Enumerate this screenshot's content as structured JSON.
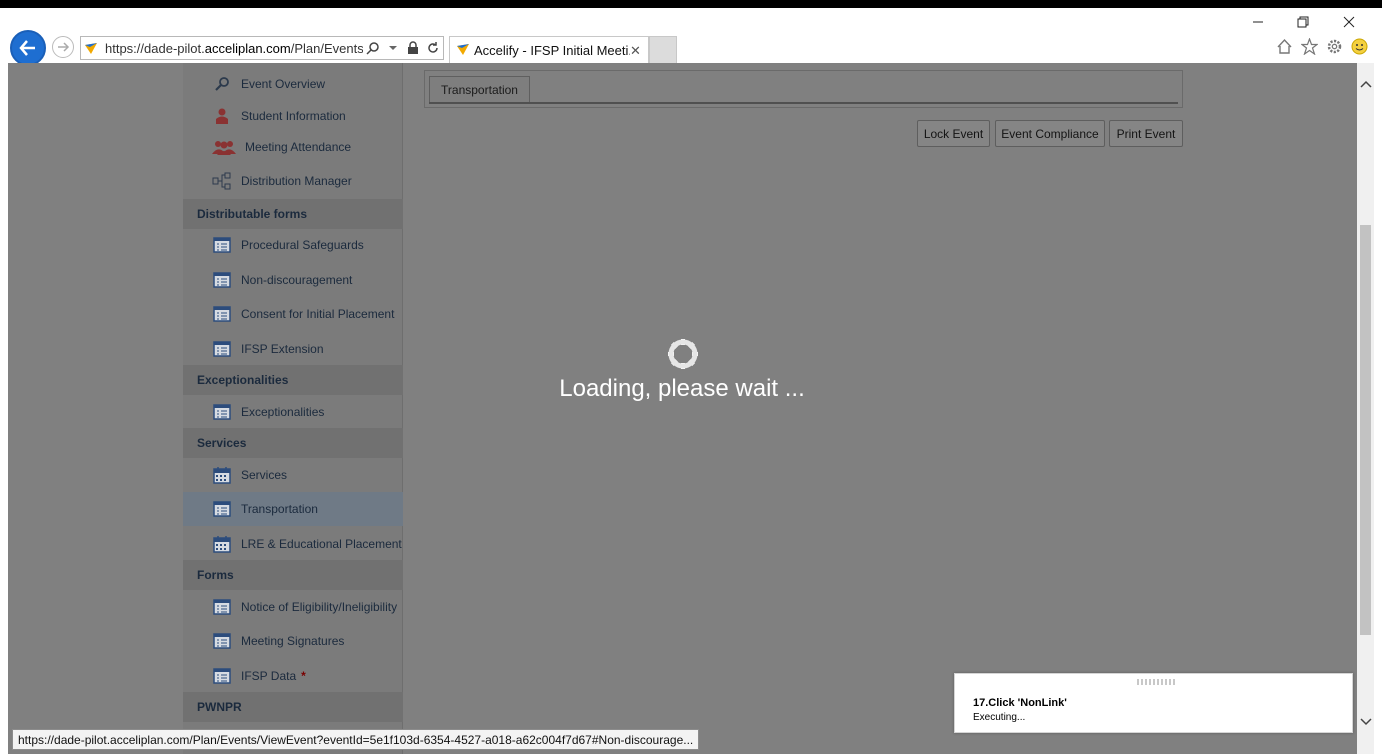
{
  "browser": {
    "address": {
      "prefix": "https://dade-pilot.",
      "domain": "acceliplan.com",
      "path": "/Plan/Events/View"
    },
    "tab_title": "Accelify - IFSP Initial Meeti...",
    "tab_close": "✕"
  },
  "window_controls": {
    "minimize": "—",
    "restore": "❐",
    "close": "✕"
  },
  "sidebar": {
    "top_items": [
      {
        "label": "Event Overview",
        "icon": "magnifier-icon"
      },
      {
        "label": "Student Information",
        "icon": "person-icon"
      },
      {
        "label": "Meeting Attendance",
        "icon": "group-icon"
      },
      {
        "label": "Distribution Manager",
        "icon": "distribution-icon"
      }
    ],
    "sections": [
      {
        "heading": "Distributable forms",
        "items": [
          "Procedural Safeguards",
          "Non-discouragement",
          "Consent for Initial Placement",
          "IFSP Extension"
        ]
      },
      {
        "heading": "Exceptionalities",
        "items": [
          "Exceptionalities"
        ]
      },
      {
        "heading": "Services",
        "items": [
          "Services",
          "Transportation",
          "LRE & Educational Placement"
        ]
      },
      {
        "heading": "Forms",
        "items": [
          "Notice of Eligibility/Ineligibility",
          "Meeting Signatures",
          "IFSP Data"
        ]
      },
      {
        "heading": "PWNPR",
        "items": []
      }
    ],
    "required_marker": "*"
  },
  "content": {
    "active_tab": "Transportation",
    "buttons": {
      "lock": "Lock Event",
      "compliance": "Event Compliance",
      "print": "Print Event"
    },
    "loading_text": "Loading, please wait ..."
  },
  "status_bar": {
    "url": "https://dade-pilot.acceliplan.com/Plan/Events/ViewEvent?eventId=5e1f103d-6354-4527-a018-a62c004f7d67#Non-discourage..."
  },
  "toast": {
    "title": "17.Click 'NonLink'",
    "status": "Executing..."
  },
  "colors": {
    "overlay": "#808080",
    "accent": "#1e6ed1",
    "icon_blue": "#2c4c7c",
    "person_red": "#9a3a3a"
  }
}
